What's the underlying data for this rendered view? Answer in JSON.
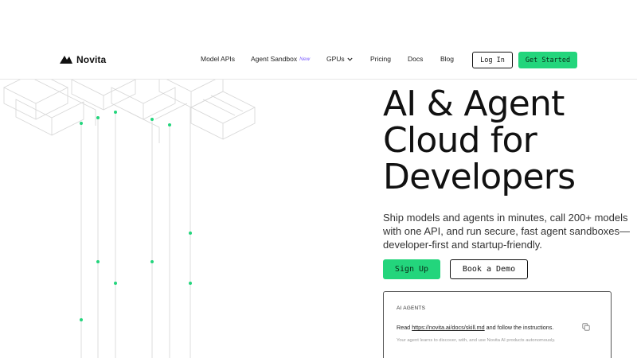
{
  "brand": {
    "name": "Novita",
    "logo_icon": "novita-logo-mark"
  },
  "nav": {
    "links": [
      {
        "label": "Model APIs"
      },
      {
        "label": "Agent Sandbox",
        "badge": "New"
      },
      {
        "label": "GPUs",
        "icon": "chevron-down-icon"
      },
      {
        "label": "Pricing"
      },
      {
        "label": "Docs"
      },
      {
        "label": "Blog"
      }
    ],
    "login_label": "Log In",
    "get_started_label": "Get Started"
  },
  "hero": {
    "title_line1": "AI & Agent",
    "title_line2": "Cloud for",
    "title_line3": "Developers",
    "subtitle": "Ship models and agents in minutes, call 200+ models with one API, and run secure, fast agent sandboxes—developer-first and startup-friendly.",
    "signup_label": "Sign Up",
    "demo_label": "Book a Demo"
  },
  "agent_card": {
    "label": "AI AGENTS",
    "instruction_prefix": "Read ",
    "instruction_link": "https://novita.ai/docs/skill.md",
    "instruction_suffix": " and follow the instructions.",
    "copy_icon": "copy-icon",
    "note": "Your agent learns to discover, with, and use Novita AI products autonomously."
  },
  "colors": {
    "accent": "#23d57c",
    "text": "#111111",
    "new_badge": "#7c5cff",
    "line_art": "#d4d4d4"
  }
}
